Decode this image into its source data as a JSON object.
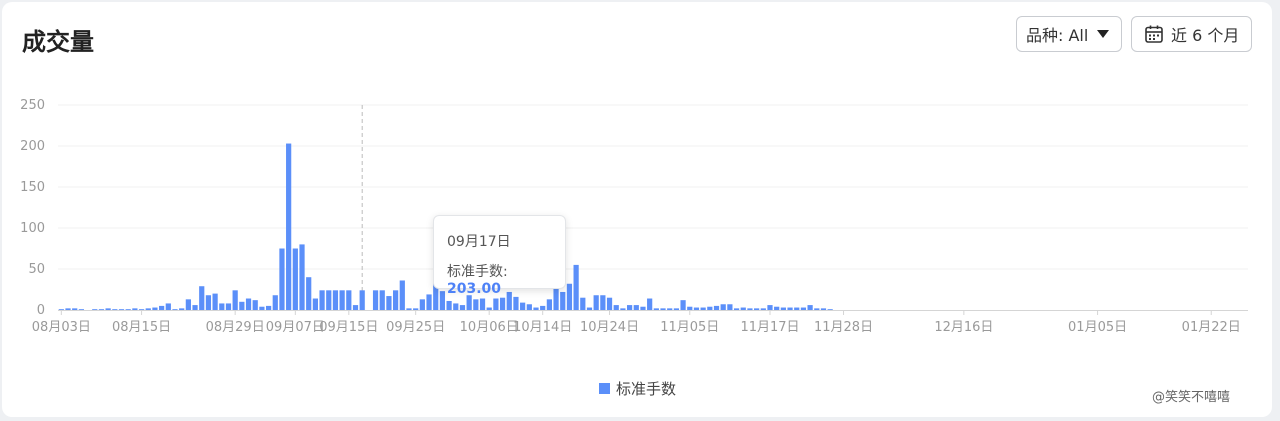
{
  "header": {
    "title": "成交量",
    "product_filter_label": "品种: All",
    "period_label": "近 6 个月"
  },
  "tooltip": {
    "date": "09月17日",
    "series_label": "标准手数",
    "value": "203.00"
  },
  "legend": {
    "label": "标准手数"
  },
  "credit": "@笑笑不嘻嘻",
  "colors": {
    "bar": "#5b8ff9",
    "tooltip_value": "#4e82f7"
  },
  "chart_data": {
    "type": "bar",
    "title": "成交量",
    "xlabel": "",
    "ylabel": "",
    "ylim": [
      0,
      250
    ],
    "yticks": [
      0,
      50,
      100,
      150,
      200,
      250
    ],
    "grid": true,
    "legend_position": "bottom",
    "categories": [
      "08月03日",
      "08月04日",
      "08月05日",
      "08月06日",
      "08月07日",
      "08月08日",
      "08月09日",
      "08月10日",
      "08月11日",
      "08月12日",
      "08月13日",
      "08月14日",
      "08月15日",
      "08月16日",
      "08月17日",
      "08月18日",
      "08月19日",
      "08月20日",
      "08月21日",
      "08月22日",
      "08月23日",
      "08月24日",
      "08月25日",
      "08月26日",
      "08月27日",
      "08月28日",
      "08月29日",
      "08月30日",
      "08月31日",
      "09月01日",
      "09月02日",
      "09月03日",
      "09月04日",
      "09月05日",
      "09月06日",
      "09月07日",
      "09月08日",
      "09月09日",
      "09月10日",
      "09月11日",
      "09月12日",
      "09月13日",
      "09月14日",
      "09月15日",
      "09月16日",
      "09月17日",
      "09月18日",
      "09月19日",
      "09月20日",
      "09月21日",
      "09月22日",
      "09月23日",
      "09月24日",
      "09月25日",
      "09月26日",
      "09月27日",
      "09月28日",
      "09月29日",
      "09月30日",
      "10月01日",
      "10月02日",
      "10月03日",
      "10月04日",
      "10月05日",
      "10月06日",
      "10月07日",
      "10月08日",
      "10月09日",
      "10月10日",
      "10月11日",
      "10月12日",
      "10月13日",
      "10月14日",
      "10月15日",
      "10月16日",
      "10月17日",
      "10月18日",
      "10月19日",
      "10月20日",
      "10月21日",
      "10月22日",
      "10月23日",
      "10月24日",
      "10月25日",
      "10月26日",
      "10月27日",
      "10月28日",
      "10月29日",
      "10月30日",
      "10月31日",
      "11月01日",
      "11月02日",
      "11月03日",
      "11月04日",
      "11月05日",
      "11月06日",
      "11月07日",
      "11月08日",
      "11月09日",
      "11月10日",
      "11月11日",
      "11月12日",
      "11月13日",
      "11月14日",
      "11月15日",
      "11月16日",
      "11月17日",
      "11月18日",
      "11月19日",
      "11月20日",
      "11月21日",
      "11月22日",
      "11月23日",
      "11月24日",
      "11月25日",
      "11月26日",
      "11月27日",
      "11月28日",
      "11月29日",
      "11月30日",
      "12月01日",
      "12月02日",
      "12月03日",
      "12月04日",
      "12月05日",
      "12月06日",
      "12月07日",
      "12月08日",
      "12月09日",
      "12月10日",
      "12月11日",
      "12月12日",
      "12月13日",
      "12月14日",
      "12月15日",
      "12月16日",
      "12月17日",
      "12月18日",
      "12月19日",
      "12月20日",
      "12月21日",
      "12月22日",
      "12月23日",
      "12月24日",
      "12月25日",
      "12月26日",
      "12月27日",
      "12月28日",
      "12月29日",
      "12月30日",
      "12月31日",
      "01月01日",
      "01月02日",
      "01月03日",
      "01月04日",
      "01月05日",
      "01月06日",
      "01月07日",
      "01月08日",
      "01月09日",
      "01月10日",
      "01月11日",
      "01月12日",
      "01月13日",
      "01月14日",
      "01月15日",
      "01月16日",
      "01月17日",
      "01月18日",
      "01月19日",
      "01月20日",
      "01月21日",
      "01月22日",
      "01月23日",
      "01月24日",
      "01月25日",
      "01月26日",
      "01月27日"
    ],
    "xtick_labels": [
      "08月03日",
      "08月15日",
      "08月29日",
      "09月07日",
      "09月15日",
      "09月25日",
      "10月06日",
      "10月14日",
      "10月24日",
      "11月05日",
      "11月17日",
      "11月28日",
      "12月16日",
      "01月05日",
      "01月22日"
    ],
    "series": [
      {
        "name": "标准手数",
        "values": [
          1,
          2,
          2,
          1,
          0,
          1,
          1,
          2,
          1,
          1,
          1,
          2,
          1,
          2,
          3,
          5,
          8,
          1,
          2,
          13,
          6,
          29,
          18,
          20,
          8,
          8,
          24,
          10,
          14,
          12,
          4,
          5,
          18,
          75,
          203,
          75,
          80,
          40,
          14,
          24,
          24,
          24,
          24,
          24,
          6,
          24,
          0,
          24,
          24,
          17,
          24,
          36,
          2,
          2,
          13,
          19,
          35,
          23,
          11,
          8,
          6,
          18,
          13,
          14,
          3,
          14,
          15,
          22,
          16,
          9,
          7,
          3,
          5,
          13,
          26,
          22,
          32,
          55,
          15,
          3,
          18,
          18,
          15,
          6,
          2,
          6,
          6,
          4,
          14,
          2,
          2,
          2,
          2,
          12,
          4,
          3,
          3,
          4,
          5,
          7,
          7,
          2,
          3,
          2,
          2,
          2,
          6,
          4,
          3,
          3,
          3,
          3,
          6,
          2,
          2,
          1
        ]
      }
    ]
  }
}
